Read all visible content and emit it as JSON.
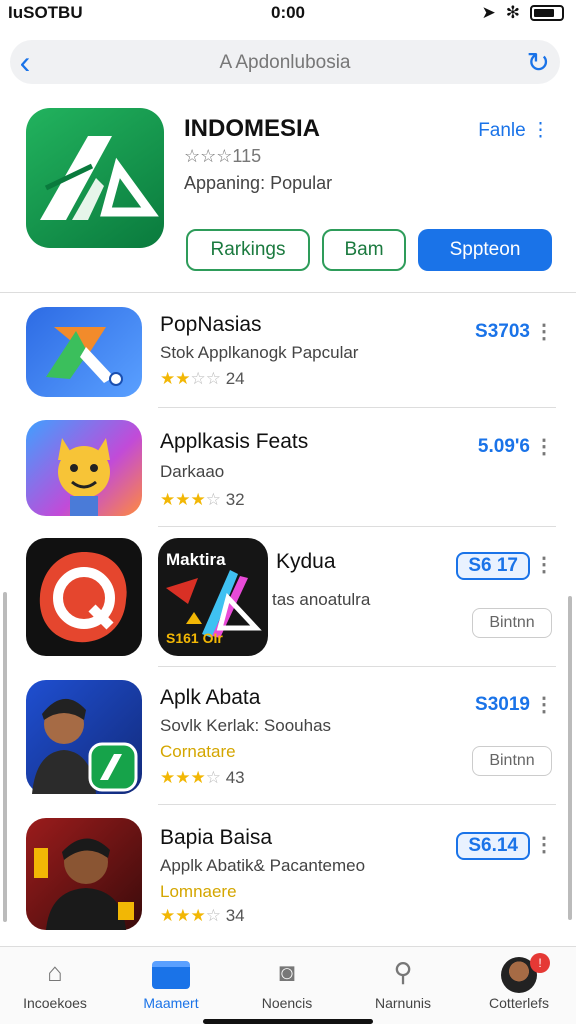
{
  "status": {
    "carrier": "IuSOTBU",
    "time": "0:00"
  },
  "browser": {
    "url": "A Apdonlubosia"
  },
  "hero": {
    "title": "INDOMESIA",
    "rating": "☆☆☆115",
    "subtitle": "Appaning: Popular",
    "link": "Fanle",
    "buttons": [
      "Rarkings",
      "Bam",
      "Sppteon"
    ]
  },
  "apps": [
    {
      "name": "PopNasias",
      "line2": "Stok Applkanogk Papcular",
      "stars": "★★",
      "stars_off": "☆☆",
      "count": "24",
      "price": "S3703"
    },
    {
      "name": "Applkasis Feats",
      "line2": "Darkaao",
      "stars": "★★★",
      "stars_off": "☆",
      "count": "32",
      "price": "5.09'6"
    },
    {
      "name": "Kydua",
      "line2": "tas anoatulra",
      "price": "S6 17",
      "get": "Bintnn",
      "tile_top": "Maktira",
      "tile_bottom": "S161 OIr"
    },
    {
      "name": "Aplk Abata",
      "line2": "Sovlk Kerlak: Soouhas",
      "line3": "Cornatare",
      "stars": "★★★",
      "stars_off": "☆",
      "count": "43",
      "price": "S3019",
      "get": "Bintnn"
    },
    {
      "name": "Bapia Baisa",
      "line2": "Applk Abatik& Pacantemeo",
      "line3": "Lomnaere",
      "stars": "★★★",
      "stars_off": "☆",
      "count": "34",
      "price": "S6.14"
    }
  ],
  "tabs": [
    "Incoekoes",
    "Maamert",
    "Noencis",
    "Narnunis",
    "Cotterlefs"
  ],
  "notification_badge": "!"
}
